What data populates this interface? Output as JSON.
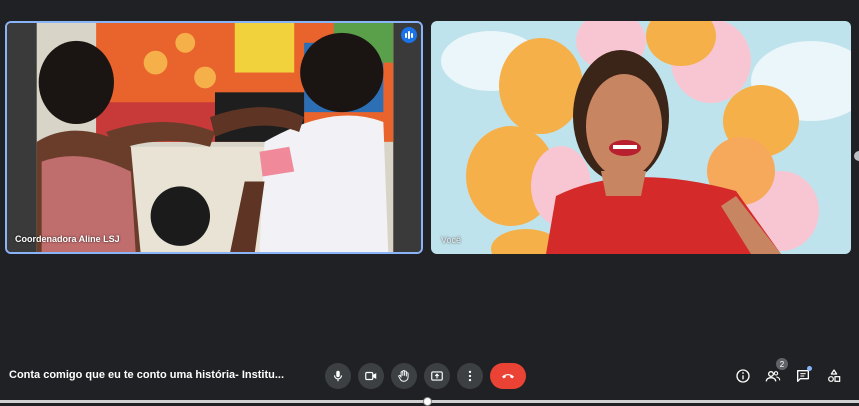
{
  "participants": [
    {
      "name": "Coordenadora Aline LSJ",
      "speaking": true
    },
    {
      "name": "Você",
      "speaking": false
    }
  ],
  "meeting": {
    "title": "Conta comigo que eu te conto uma história- Institu..."
  },
  "controls": {
    "mic_icon": "microphone-icon",
    "camera_icon": "video-camera-icon",
    "hand_icon": "raise-hand-icon",
    "present_icon": "present-screen-icon",
    "more_icon": "more-options-icon",
    "hangup_icon": "end-call-icon"
  },
  "side_panel": {
    "info_icon": "info-icon",
    "people_icon": "people-icon",
    "people_count": "2",
    "chat_icon": "chat-icon",
    "activities_icon": "activities-icon"
  },
  "colors": {
    "background": "#202124",
    "active_speaker_border": "#8ab4f8",
    "hangup": "#ea4335",
    "control_bg": "#3c4043"
  }
}
